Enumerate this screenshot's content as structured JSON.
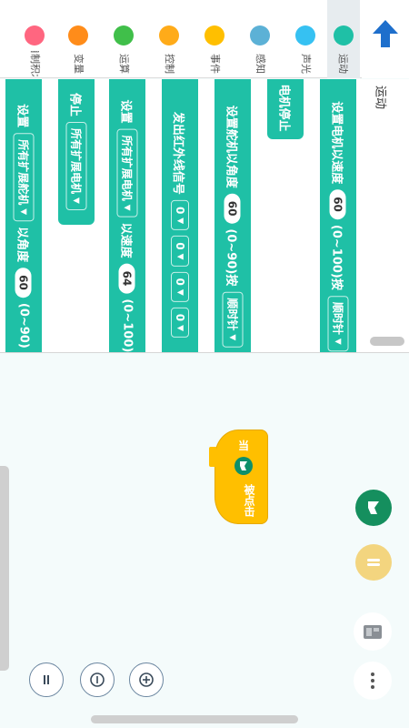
{
  "categories": [
    {
      "label": "自制积木",
      "color": "#ff6680"
    },
    {
      "label": "变量",
      "color": "#ff8c1a"
    },
    {
      "label": "运算",
      "color": "#40bf4a"
    },
    {
      "label": "控制",
      "color": "#ffab19"
    },
    {
      "label": "事件",
      "color": "#ffbf00"
    },
    {
      "label": "感知",
      "color": "#5cb1d6"
    },
    {
      "label": "声光",
      "color": "#36c1f2"
    },
    {
      "label": "运动",
      "color": "#1fc0a6"
    }
  ],
  "palette": {
    "title": "运动",
    "blocks": [
      {
        "parts": [
          "设置电机以速度",
          "60",
          "(0~100)按",
          "顺时针"
        ]
      },
      {
        "parts": [
          "电机停止"
        ]
      },
      {
        "parts": [
          "设置舵机以角度",
          "60",
          "(0~90)按",
          "顺时针"
        ]
      },
      {
        "parts": [
          "发出红外线信号",
          "0",
          "0",
          "0",
          "0"
        ]
      },
      {
        "parts": [
          "设置",
          "所有扩展电机",
          "以速度",
          "64",
          "(0~100)"
        ]
      },
      {
        "parts": [
          "停止",
          "所有扩展电机"
        ]
      },
      {
        "parts": [
          "设置",
          "所有扩展舵机",
          "以角度",
          "60",
          "(0~90)"
        ]
      }
    ]
  },
  "workspace": {
    "hat_block": {
      "when": "当",
      "clicked": "被点击"
    }
  },
  "colors": {
    "motion": "#1fc0a6",
    "events": "#ffbf00",
    "accent_blue": "#1e6fcc"
  }
}
